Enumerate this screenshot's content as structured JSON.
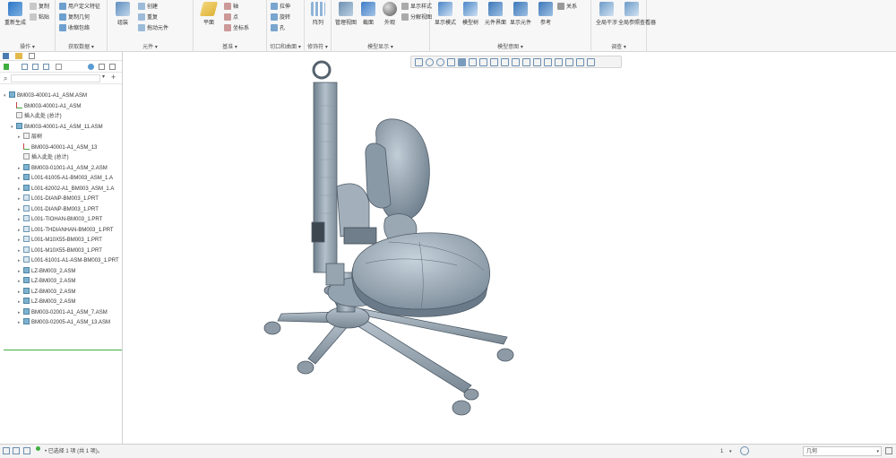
{
  "colors": {
    "ribbon_bg": "#f7f7f7",
    "accent": "#2b74c8",
    "model": "#9aa9b6",
    "model_dark": "#5d6b78",
    "selection_line": "#3fae3f"
  },
  "ribbon": {
    "groups": [
      {
        "label": "操作 ▾",
        "buttons": [
          "重新生成",
          "复制",
          "粘贴"
        ]
      },
      {
        "label": "获取数据 ▾",
        "buttons": [
          "用户定义特征",
          "复制几何",
          "收缩包络"
        ]
      },
      {
        "label": "元件 ▾",
        "buttons": [
          "组装",
          "创建",
          "重复",
          "拖动元件"
        ]
      },
      {
        "label": "基准 ▾",
        "buttons": [
          "平面",
          "轴",
          "点",
          "坐标系"
        ]
      },
      {
        "label": "切口和曲面 ▾",
        "buttons": [
          "拉伸",
          "旋转",
          "孔"
        ]
      },
      {
        "label": "修饰符 ▾",
        "buttons": [
          "阵列"
        ]
      },
      {
        "label": "模型显示 ▾",
        "buttons": [
          "管理视图",
          "截面",
          "外观",
          "显示样式",
          "分解视图"
        ]
      },
      {
        "label": "模型意图 ▾",
        "buttons": [
          "显示模式",
          "模型树",
          "元件界面",
          "显示元件",
          "参考",
          "关系"
        ]
      },
      {
        "label": "调查 ▾",
        "buttons": [
          "全局干涉",
          "全局参照查看器"
        ]
      }
    ]
  },
  "left_panel": {
    "tabs": [
      "model-tree-tab",
      "folder-tab",
      "favorites-tab"
    ],
    "tree": [
      {
        "label": "BM003-40001-A1_ASM.ASM",
        "type": "asm",
        "level": 0,
        "expander": "▾"
      },
      {
        "label": "BM003-40001-A1_ASM",
        "type": "csys",
        "level": 1,
        "expander": ""
      },
      {
        "label": "插入此处 (总计)",
        "type": "feat",
        "level": 1,
        "expander": ""
      },
      {
        "label": "BM003-40001-A1_ASM_11.ASM",
        "type": "asm",
        "level": 1,
        "expander": "▾"
      },
      {
        "label": "层树",
        "type": "feat",
        "level": 2,
        "expander": "▸"
      },
      {
        "label": "BM003-40001-A1_ASM_13",
        "type": "csys",
        "level": 2,
        "expander": ""
      },
      {
        "label": "插入此处 (总计)",
        "type": "feat",
        "level": 2,
        "expander": ""
      },
      {
        "label": "BM003-01001-A1_ASM_2.ASM",
        "type": "asm",
        "level": 2,
        "expander": "▸"
      },
      {
        "label": "L001-61005-A1-BM003_ASM_1.A",
        "type": "asm",
        "level": 2,
        "expander": "▸"
      },
      {
        "label": "L001-62002-A1_BM003_ASM_1.A",
        "type": "asm",
        "level": 2,
        "expander": "▸"
      },
      {
        "label": "L001-DIANP-BM003_1.PRT",
        "type": "prt",
        "level": 2,
        "expander": "▸"
      },
      {
        "label": "L001-DIANP-BM003_1.PRT",
        "type": "prt",
        "level": 2,
        "expander": "▸"
      },
      {
        "label": "L001-TIOHAN-BM003_1.PRT",
        "type": "prt",
        "level": 2,
        "expander": "▸"
      },
      {
        "label": "L001-THDIANHAN-BM003_1.PRT",
        "type": "prt",
        "level": 2,
        "expander": "▸"
      },
      {
        "label": "L001-M10X55-BM003_1.PRT",
        "type": "prt",
        "level": 2,
        "expander": "▸"
      },
      {
        "label": "L001-M10X55-BM003_1.PRT",
        "type": "prt",
        "level": 2,
        "expander": "▸"
      },
      {
        "label": "L001-61001-A1-ASM-BM003_1.PRT",
        "type": "prt",
        "level": 2,
        "expander": "▸"
      },
      {
        "label": "LZ-BM003_2.ASM",
        "type": "asm",
        "level": 2,
        "expander": "▸"
      },
      {
        "label": "LZ-BM003_2.ASM",
        "type": "asm",
        "level": 2,
        "expander": "▸"
      },
      {
        "label": "LZ-BM003_2.ASM",
        "type": "asm",
        "level": 2,
        "expander": "▸"
      },
      {
        "label": "LZ-BM003_2.ASM",
        "type": "asm",
        "level": 2,
        "expander": "▸"
      },
      {
        "label": "BM003-02001-A1_ASM_7.ASM",
        "type": "asm",
        "level": 2,
        "expander": "▸"
      },
      {
        "label": "BM003-02005-A1_ASM_13.ASM",
        "type": "asm",
        "level": 2,
        "expander": "▸"
      }
    ]
  },
  "status_bar": {
    "message": "• 已选择 1 项 (共 1 项)。",
    "filter_label": "几何",
    "selection_count": "1"
  }
}
